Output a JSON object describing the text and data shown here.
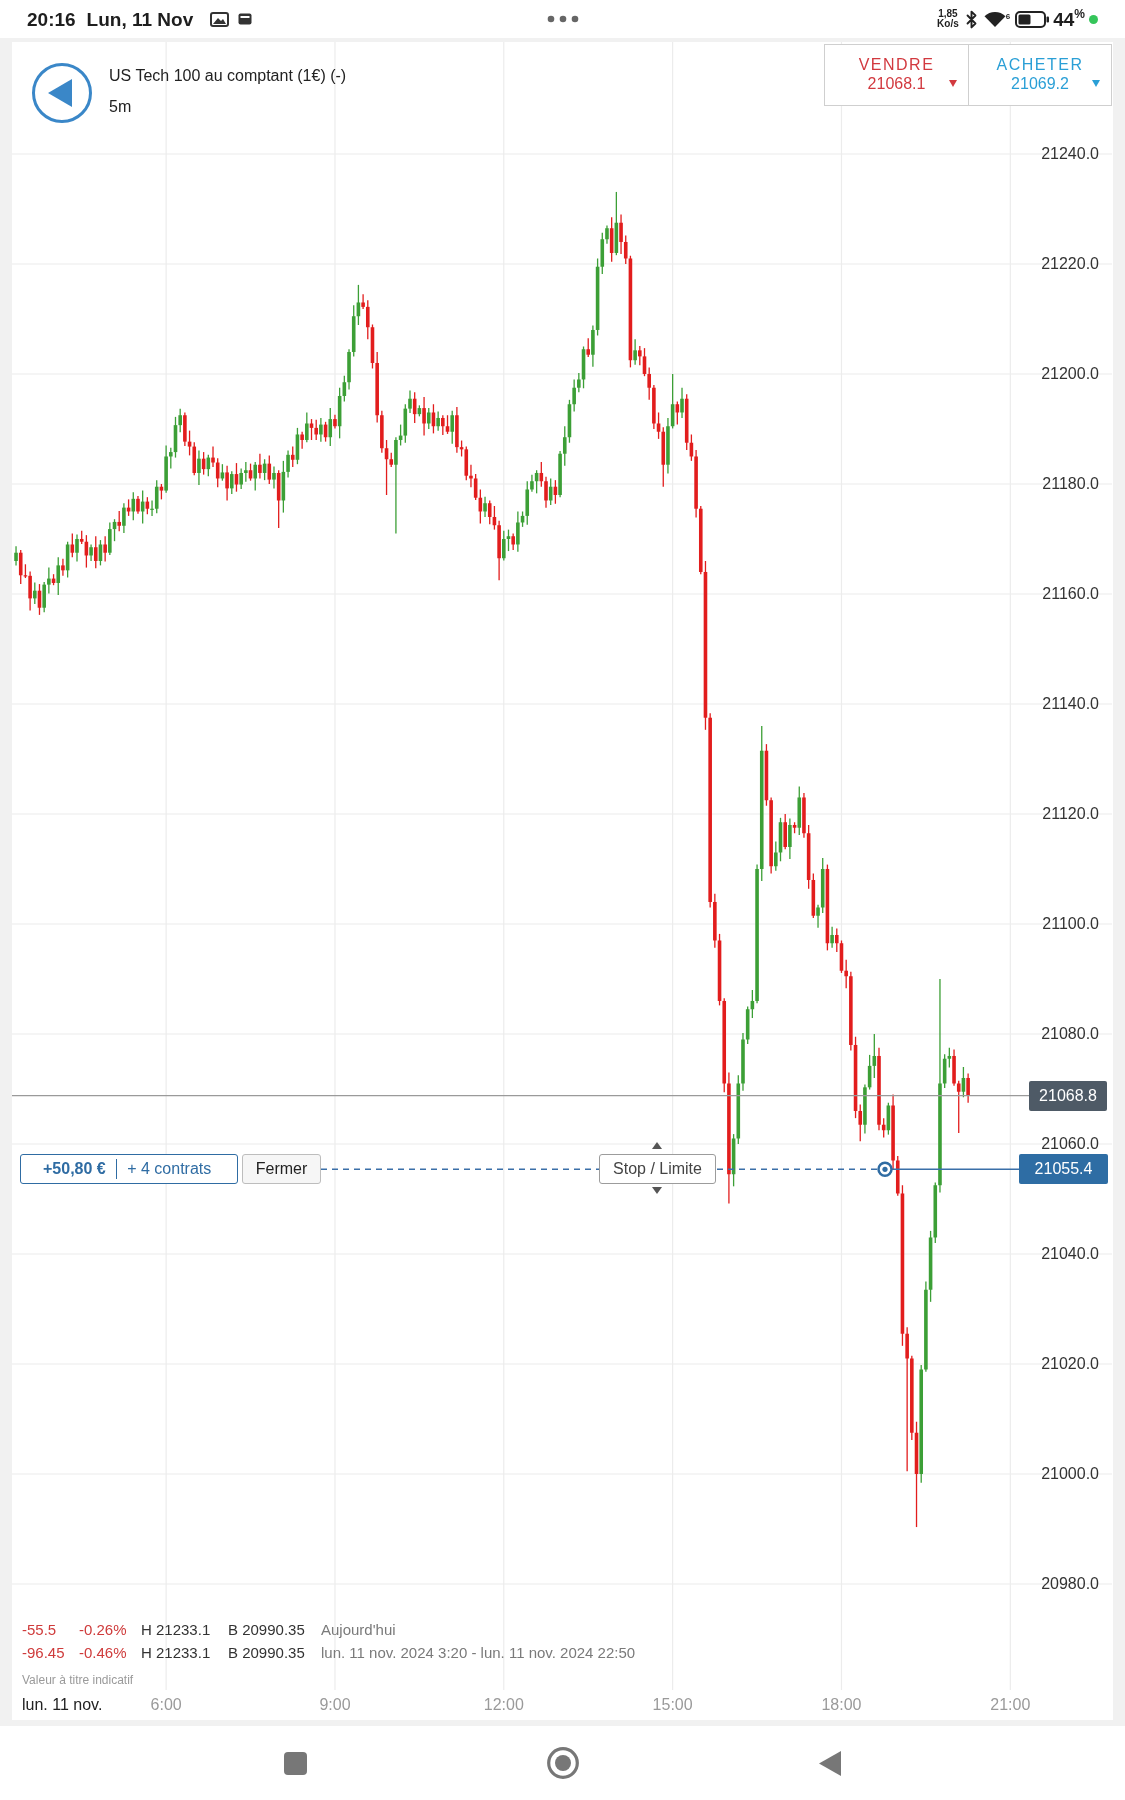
{
  "status_bar": {
    "time": "20:16",
    "date": "Lun, 11 Nov",
    "net_speed": "1,85",
    "net_speed_unit": "Ko/s",
    "wifi_label": "6",
    "battery": "44",
    "battery_unit": "%"
  },
  "header": {
    "title": "US Tech 100 au comptant (1€) (-)",
    "interval": "5m"
  },
  "quotes": [
    {
      "kind": "sell",
      "label": "VENDRE",
      "price": "21068.1"
    },
    {
      "kind": "buy",
      "label": "ACHETER",
      "price": "21069.2"
    }
  ],
  "chart": {
    "chart_data": {
      "type": "candlestick",
      "grid": true,
      "xlim": [
        195.7,
        1368.4
      ],
      "ylim": [
        20955.27,
        21260.36
      ],
      "xticks": [
        {
          "value": 360,
          "label": "6:00"
        },
        {
          "value": 540,
          "label": "9:00"
        },
        {
          "value": 720,
          "label": "12:00"
        },
        {
          "value": 900,
          "label": "15:00"
        },
        {
          "value": 1080,
          "label": "18:00"
        },
        {
          "value": 1260,
          "label": "21:00"
        }
      ],
      "yticks": [
        {
          "value": 21240,
          "label": "21240.0"
        },
        {
          "value": 21220,
          "label": "21220.0"
        },
        {
          "value": 21200,
          "label": "21200.0"
        },
        {
          "value": 21180,
          "label": "21180.0"
        },
        {
          "value": 21160,
          "label": "21160.0"
        },
        {
          "value": 21140,
          "label": "21140.0"
        },
        {
          "value": 21120,
          "label": "21120.0"
        },
        {
          "value": 21100,
          "label": "21100.0"
        },
        {
          "value": 21080,
          "label": "21080.0"
        },
        {
          "value": 21060,
          "label": "21060.0"
        },
        {
          "value": 21040,
          "label": "21040.0"
        },
        {
          "value": 21020,
          "label": "21020.0"
        },
        {
          "value": 21000,
          "label": "21000.0"
        },
        {
          "value": 20980,
          "label": "20980.0"
        }
      ],
      "x": [
        200,
        205,
        210,
        215,
        220,
        225,
        230,
        235,
        240,
        245,
        250,
        255,
        260,
        265,
        270,
        275,
        280,
        285,
        290,
        295,
        300,
        305,
        310,
        315,
        320,
        325,
        330,
        335,
        340,
        345,
        350,
        355,
        360,
        365,
        370,
        375,
        380,
        385,
        390,
        395,
        400,
        405,
        410,
        415,
        420,
        425,
        430,
        435,
        440,
        445,
        450,
        455,
        460,
        465,
        470,
        475,
        480,
        485,
        490,
        495,
        500,
        505,
        510,
        515,
        520,
        525,
        530,
        535,
        540,
        545,
        550,
        555,
        560,
        565,
        570,
        575,
        580,
        585,
        590,
        595,
        600,
        605,
        610,
        615,
        620,
        625,
        630,
        635,
        640,
        645,
        650,
        655,
        660,
        665,
        670,
        675,
        680,
        685,
        690,
        695,
        700,
        705,
        710,
        715,
        720,
        725,
        730,
        735,
        740,
        745,
        750,
        755,
        760,
        765,
        770,
        775,
        780,
        785,
        790,
        795,
        800,
        805,
        810,
        815,
        820,
        825,
        830,
        835,
        840,
        845,
        850,
        855,
        860,
        865,
        870,
        875,
        880,
        885,
        890,
        895,
        900,
        905,
        910,
        915,
        920,
        925,
        930,
        935,
        940,
        945,
        950,
        955,
        960,
        965,
        970,
        975,
        980,
        985,
        990,
        995,
        1000,
        1005,
        1010,
        1015,
        1020,
        1025,
        1030,
        1035,
        1040,
        1045,
        1050,
        1055,
        1060,
        1065,
        1070,
        1075,
        1080,
        1085,
        1090,
        1095,
        1100,
        1105,
        1110,
        1115,
        1120,
        1125,
        1130,
        1135,
        1140,
        1145,
        1150,
        1155,
        1160,
        1165,
        1170,
        1175,
        1180,
        1185,
        1190,
        1195,
        1200,
        1205,
        1210,
        1215
      ],
      "ohlc": [
        [
          21166,
          21168.7,
          21165.2,
          21167.5
        ],
        [
          21167.5,
          21168,
          21161.8,
          21163.4
        ],
        [
          21163.4,
          21165.4,
          21162.9,
          21163.3
        ],
        [
          21163.3,
          21164.1,
          21157,
          21159.2
        ],
        [
          21159.2,
          21162.1,
          21158.2,
          21160.6
        ],
        [
          21160.6,
          21161.8,
          21156.2,
          21157.5
        ],
        [
          21157.5,
          21162.2,
          21156.7,
          21161.7
        ],
        [
          21161.7,
          21164.8,
          21160.1,
          21162.8
        ],
        [
          21162.8,
          21163.6,
          21161.6,
          21162
        ],
        [
          21162,
          21166.7,
          21159.8,
          21165.2
        ],
        [
          21165.2,
          21166.4,
          21163.3,
          21164.3
        ],
        [
          21164.3,
          21169.5,
          21163,
          21169
        ],
        [
          21169,
          21171,
          21166.7,
          21167.5
        ],
        [
          21167.5,
          21170.8,
          21165.9,
          21170
        ],
        [
          21170,
          21171.5,
          21169.1,
          21169.5
        ],
        [
          21169.5,
          21170.7,
          21164.8,
          21167
        ],
        [
          21167,
          21169,
          21166,
          21168.5
        ],
        [
          21168.5,
          21170.5,
          21164.7,
          21166
        ],
        [
          21166,
          21169.8,
          21165.2,
          21169
        ],
        [
          21169,
          21170.5,
          21165.9,
          21167.5
        ],
        [
          21167.5,
          21173,
          21167.1,
          21171.8
        ],
        [
          21171.8,
          21173.6,
          21169.6,
          21173.1
        ],
        [
          21173.1,
          21175.1,
          21171.4,
          21172.4
        ],
        [
          21172.4,
          21176.5,
          21171.1,
          21175.7
        ],
        [
          21175.7,
          21177.2,
          21174.2,
          21175
        ],
        [
          21175,
          21178.5,
          21173.4,
          21177.3
        ],
        [
          21177.3,
          21177.8,
          21174.6,
          21175
        ],
        [
          21175,
          21178.8,
          21172.8,
          21176.8
        ],
        [
          21176.8,
          21177.6,
          21174.5,
          21175.5
        ],
        [
          21175.5,
          21177,
          21174.2,
          21175.5
        ],
        [
          21175.5,
          21180.7,
          21174.7,
          21179.5
        ],
        [
          21179.5,
          21180,
          21177.2,
          21178.8
        ],
        [
          21178.8,
          21187,
          21178.4,
          21185
        ],
        [
          21185,
          21186.6,
          21182.8,
          21185.8
        ],
        [
          21185.8,
          21192.2,
          21184.8,
          21190.7
        ],
        [
          21190.7,
          21193.7,
          21189.4,
          21192.5
        ],
        [
          21192.5,
          21193,
          21186.9,
          21187.7
        ],
        [
          21187.7,
          21189.7,
          21185.2,
          21186.8
        ],
        [
          21186.8,
          21187.6,
          21181.6,
          21182
        ],
        [
          21182,
          21186.1,
          21179.8,
          21184.6
        ],
        [
          21184.6,
          21185.8,
          21181.7,
          21182.7
        ],
        [
          21182.7,
          21185.3,
          21181.4,
          21184.8
        ],
        [
          21184.8,
          21186.8,
          21183.1,
          21183.9
        ],
        [
          21183.9,
          21184.7,
          21179.4,
          21181
        ],
        [
          21181,
          21183.6,
          21180.6,
          21182.1
        ],
        [
          21182.1,
          21183.3,
          21177,
          21179.2
        ],
        [
          21179.2,
          21182.3,
          21178.2,
          21181.8
        ],
        [
          21181.8,
          21183.8,
          21178.6,
          21179.9
        ],
        [
          21179.9,
          21182.8,
          21179.1,
          21182
        ],
        [
          21182,
          21184,
          21180.4,
          21182.5
        ],
        [
          21182.5,
          21183.7,
          21180.6,
          21181
        ],
        [
          21181,
          21184,
          21178.8,
          21183.5
        ],
        [
          21183.5,
          21185.5,
          21181,
          21182
        ],
        [
          21182,
          21184.5,
          21180.7,
          21183.7
        ],
        [
          21183.7,
          21185.2,
          21180,
          21180.8
        ],
        [
          21180.8,
          21183.2,
          21179.2,
          21182
        ],
        [
          21182,
          21182.5,
          21172,
          21177
        ],
        [
          21177,
          21184.2,
          21174.8,
          21182.2
        ],
        [
          21182.2,
          21186.1,
          21181.2,
          21185.3
        ],
        [
          21185.3,
          21186.8,
          21183.1,
          21184.4
        ],
        [
          21184.4,
          21190.2,
          21183.6,
          21189
        ],
        [
          21189,
          21189.5,
          21186.4,
          21188
        ],
        [
          21188,
          21193,
          21187.6,
          21191
        ],
        [
          21191,
          21191.8,
          21188,
          21190.2
        ],
        [
          21190.2,
          21191.7,
          21188,
          21189
        ],
        [
          21189,
          21192,
          21187.7,
          21190.8
        ],
        [
          21190.8,
          21191.3,
          21187.7,
          21188.5
        ],
        [
          21188.5,
          21193.8,
          21186.9,
          21191.8
        ],
        [
          21191.8,
          21192.6,
          21190.1,
          21190.5
        ],
        [
          21190.5,
          21197.5,
          21188.3,
          21196
        ],
        [
          21196,
          21199.7,
          21195,
          21198.5
        ],
        [
          21198.5,
          21204.5,
          21197.2,
          21204
        ],
        [
          21204,
          21212.5,
          21203.2,
          21210.5
        ],
        [
          21210.5,
          21216.2,
          21208.9,
          21213
        ],
        [
          21213,
          21214.5,
          21211.8,
          21212.2
        ],
        [
          21212.2,
          21213.4,
          21206.3,
          21208.5
        ],
        [
          21208.5,
          21209,
          21201,
          21202
        ],
        [
          21202,
          21204,
          21191.2,
          21192.5
        ],
        [
          21192.5,
          21193.3,
          21185.7,
          21186.5
        ],
        [
          21186.5,
          21188,
          21178,
          21184.5
        ],
        [
          21184.5,
          21185.7,
          21183.1,
          21183.5
        ],
        [
          21183.5,
          21188.5,
          21171,
          21188
        ],
        [
          21188,
          21190.8,
          21187,
          21188.8
        ],
        [
          21188.8,
          21194.5,
          21187.5,
          21193.7
        ],
        [
          21193.7,
          21197,
          21192.9,
          21195.5
        ],
        [
          21195.5,
          21196.7,
          21191.1,
          21192.7
        ],
        [
          21192.7,
          21194.3,
          21192.3,
          21193.8
        ],
        [
          21193.8,
          21195.8,
          21188.8,
          21191
        ],
        [
          21191,
          21193.8,
          21190,
          21193
        ],
        [
          21193,
          21194.5,
          21189.2,
          21190.5
        ],
        [
          21190.5,
          21193.2,
          21189.7,
          21192
        ],
        [
          21192,
          21192.5,
          21188.9,
          21190.5
        ],
        [
          21190.5,
          21192.5,
          21189.1,
          21189.5
        ],
        [
          21189.5,
          21193.3,
          21187.3,
          21192.5
        ],
        [
          21192.5,
          21194,
          21185.7,
          21186.7
        ],
        [
          21186.7,
          21187.9,
          21185,
          21186.3
        ],
        [
          21186.3,
          21186.8,
          21180.7,
          21181.5
        ],
        [
          21181.5,
          21183.5,
          21179.4,
          21181
        ],
        [
          21181,
          21181.8,
          21177.1,
          21177.5
        ],
        [
          21177.5,
          21179,
          21172.8,
          21175
        ],
        [
          21175,
          21177.7,
          21174,
          21176.5
        ],
        [
          21176.5,
          21177,
          21172.7,
          21174
        ],
        [
          21174,
          21176,
          21171.7,
          21172.5
        ],
        [
          21172.5,
          21173.3,
          21162.5,
          21166.5
        ],
        [
          21166.5,
          21171.5,
          21166.1,
          21170
        ],
        [
          21170,
          21171.7,
          21167.8,
          21170.5
        ],
        [
          21170.5,
          21171,
          21168,
          21169
        ],
        [
          21169,
          21175,
          21167.7,
          21173
        ],
        [
          21173,
          21175,
          21172.2,
          21174.2
        ],
        [
          21174.2,
          21180.5,
          21172.6,
          21179
        ],
        [
          21179,
          21181.7,
          21178.6,
          21180.5
        ],
        [
          21180.5,
          21182.5,
          21178.3,
          21182
        ],
        [
          21182,
          21184,
          21179.5,
          21180.5
        ],
        [
          21180.5,
          21181.3,
          21175.7,
          21177
        ],
        [
          21177,
          21181,
          21176.2,
          21179.5
        ],
        [
          21179.5,
          21180.7,
          21176.4,
          21178
        ],
        [
          21178,
          21186,
          21177.6,
          21185.5
        ],
        [
          21185.5,
          21190.5,
          21183.3,
          21188.5
        ],
        [
          21188.5,
          21195.3,
          21187.5,
          21194.5
        ],
        [
          21194.5,
          21199,
          21193.2,
          21197.5
        ],
        [
          21197.5,
          21200.2,
          21196.7,
          21199
        ],
        [
          21199,
          21205,
          21197.4,
          21204.5
        ],
        [
          21204.5,
          21206.5,
          21203.1,
          21203.5
        ],
        [
          21203.5,
          21208.8,
          21201.3,
          21208
        ],
        [
          21208,
          21221,
          21207,
          21219.5
        ],
        [
          21219.5,
          21225.7,
          21218.2,
          21224.5
        ],
        [
          21224.5,
          21227,
          21223.7,
          21226.5
        ],
        [
          21226.5,
          21228.5,
          21220.4,
          21222
        ],
        [
          21222,
          21233.1,
          21221.6,
          21227.5
        ],
        [
          21227.5,
          21229,
          21221.8,
          21224
        ],
        [
          21224,
          21225.2,
          21220,
          21221
        ],
        [
          21221,
          21221.5,
          21201.2,
          21202.5
        ],
        [
          21202.5,
          21206.3,
          21201.7,
          21204.3
        ],
        [
          21204.3,
          21205.1,
          21201.6,
          21203.2
        ],
        [
          21203.2,
          21204.7,
          21199.6,
          21200
        ],
        [
          21200,
          21201.2,
          21195.3,
          21197.5
        ],
        [
          21197.5,
          21198,
          21190,
          21191
        ],
        [
          21191,
          21193,
          21188.2,
          21189.5
        ],
        [
          21189.5,
          21190.3,
          21179.5,
          21183.5
        ],
        [
          21183.5,
          21192,
          21181.9,
          21190.5
        ],
        [
          21190.5,
          21200,
          21190.1,
          21194.5
        ],
        [
          21194.5,
          21195,
          21190.8,
          21193
        ],
        [
          21193,
          21197.5,
          21192,
          21195.5
        ],
        [
          21195.5,
          21196.3,
          21186.2,
          21187.5
        ],
        [
          21187.5,
          21189,
          21184.2,
          21185
        ],
        [
          21185,
          21186.2,
          21173.9,
          21175.5
        ],
        [
          21175.5,
          21176,
          21163.6,
          21164
        ],
        [
          21164,
          21166,
          21135.3,
          21137.5
        ],
        [
          21137.5,
          21138.3,
          21103,
          21104
        ],
        [
          21104,
          21105.5,
          21095.7,
          21097
        ],
        [
          21097,
          21098.2,
          21085.2,
          21086
        ],
        [
          21086,
          21086.5,
          21069.4,
          21071
        ],
        [
          21071,
          21073,
          21049.2,
          21054.5
        ],
        [
          21054.5,
          21061.8,
          21052.3,
          21061
        ],
        [
          21061,
          21072.5,
          21060,
          21071
        ],
        [
          21071,
          21080.2,
          21069.7,
          21079
        ],
        [
          21079,
          21085,
          21078.2,
          21084.5
        ],
        [
          21084.5,
          21088,
          21082.9,
          21086
        ],
        [
          21086,
          21110.8,
          21085.6,
          21110
        ],
        [
          21110,
          21136,
          21107.8,
          21131.5
        ],
        [
          21131.5,
          21132.7,
          21121.5,
          21122.5
        ],
        [
          21122.5,
          21123,
          21109.2,
          21110.5
        ],
        [
          21110.5,
          21115,
          21109.7,
          21113
        ],
        [
          21113,
          21119.3,
          21111.4,
          21118.5
        ],
        [
          21118.5,
          21120,
          21113.6,
          21114
        ],
        [
          21114,
          21119.2,
          21111.8,
          21118
        ],
        [
          21118,
          21118.5,
          21116.5,
          21117.5
        ],
        [
          21117.5,
          21125,
          21116.2,
          21123
        ],
        [
          21123,
          21123.8,
          21115.7,
          21116.5
        ],
        [
          21116.5,
          21118,
          21106.4,
          21108
        ],
        [
          21108,
          21109.2,
          21101.1,
          21101.5
        ],
        [
          21101.5,
          21103.5,
          21099.3,
          21103
        ],
        [
          21103,
          21112,
          21102,
          21110
        ],
        [
          21110,
          21110.8,
          21095.2,
          21096.5
        ],
        [
          21096.5,
          21099.5,
          21095.7,
          21098
        ],
        [
          21098,
          21099.2,
          21094.9,
          21096.5
        ],
        [
          21096.5,
          21097,
          21091.1,
          21091.5
        ],
        [
          21091.5,
          21093.5,
          21088.3,
          21090.5
        ],
        [
          21090.5,
          21091.3,
          21077,
          21078
        ],
        [
          21078,
          21079.5,
          21064.7,
          21066
        ],
        [
          21066,
          21067.2,
          21060.5,
          21063.5
        ],
        [
          21063.5,
          21070.8,
          21061.9,
          21070.3
        ],
        [
          21070.3,
          21076.2,
          21069.9,
          21074.2
        ],
        [
          21074.2,
          21080,
          21072,
          21076
        ],
        [
          21076,
          21077.5,
          21062.5,
          21063.5
        ],
        [
          21063.5,
          21064.7,
          21061.2,
          21062.5
        ],
        [
          21062.5,
          21067.5,
          21061.7,
          21067
        ],
        [
          21067,
          21069,
          21055.4,
          21057
        ],
        [
          21057,
          21057.8,
          21050.6,
          21051
        ],
        [
          21051,
          21052.5,
          21023.3,
          21025.5
        ],
        [
          21025.5,
          21026.7,
          21000.5,
          21021
        ],
        [
          21021,
          21021.5,
          21006.2,
          21007.5
        ],
        [
          21007.5,
          21009.5,
          20990.35,
          21000
        ],
        [
          21000,
          21019.8,
          20998.4,
          21019
        ],
        [
          21019,
          21035,
          21018.6,
          21033.5
        ],
        [
          21033.5,
          21044.2,
          21031.3,
          21043
        ],
        [
          21043,
          21053,
          21042,
          21052.5
        ],
        [
          21052.5,
          21090,
          21051.2,
          21071
        ],
        [
          21071,
          21076.3,
          21070.2,
          21075.5
        ],
        [
          21075.5,
          21077.5,
          21073.9,
          21076
        ],
        [
          21076,
          21077.2,
          21070.6,
          21071
        ],
        [
          21071,
          21071.5,
          21062,
          21069.5
        ],
        [
          21069.5,
          21074,
          21068.5,
          21072
        ],
        [
          21072,
          21072.8,
          21067.5,
          21068.8
        ]
      ]
    },
    "last_price": "21068.8",
    "position_price": "21055.4",
    "date_label": "lun. 11 nov."
  },
  "position": {
    "profit": "+50,80 €",
    "size": "+ 4 contrats",
    "close_button": "Fermer",
    "stop_limit_button": "Stop / Limite"
  },
  "stats": [
    {
      "change": "-55.5",
      "change_percent": "-0.26%",
      "high": "H 21233.1",
      "low": "B 20990.35",
      "period": "Aujourd'hui"
    },
    {
      "change": "-96.45",
      "change_percent": "-0.46%",
      "high": "H 21233.1",
      "low": "B 20990.35",
      "period": "lun. 11 nov. 2024 3:20 - lun. 11 nov. 2024 22:50"
    }
  ],
  "note": "Valeur à titre indicatif"
}
